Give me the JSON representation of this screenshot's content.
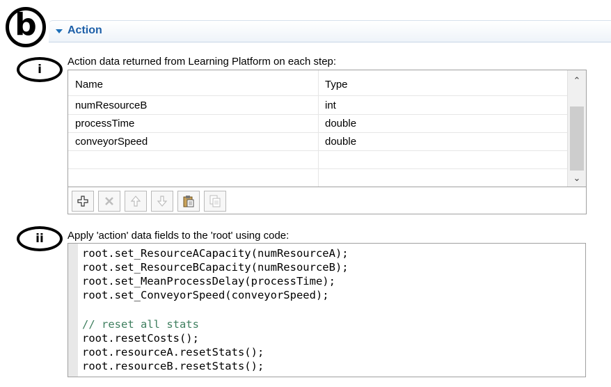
{
  "annotations": {
    "section": "b",
    "part1": "i",
    "part2": "ii"
  },
  "section": {
    "title": "Action"
  },
  "action_table": {
    "caption": "Action data returned from Learning Platform on each step:",
    "columns": [
      "Name",
      "Type"
    ],
    "rows": [
      {
        "name": "numResourceB",
        "type": "int"
      },
      {
        "name": "processTime",
        "type": "double"
      },
      {
        "name": "conveyorSpeed",
        "type": "double"
      }
    ],
    "toolbar": [
      "add-icon",
      "delete-icon",
      "move-up-icon",
      "move-down-icon",
      "paste-icon",
      "copy-icon"
    ]
  },
  "code_section": {
    "caption": "Apply 'action' data fields to the 'root' using code:",
    "lines": [
      "root.set_ResourceACapacity(numResourceA);",
      "root.set_ResourceBCapacity(numResourceB);",
      "root.set_MeanProcessDelay(processTime);",
      "root.set_ConveyorSpeed(conveyorSpeed);",
      "",
      "// reset all stats",
      "root.resetCosts();",
      "root.resourceA.resetStats();",
      "root.resourceB.resetStats();"
    ]
  },
  "colors": {
    "accent": "#1d5fa8",
    "comment": "#3f7f5f"
  }
}
